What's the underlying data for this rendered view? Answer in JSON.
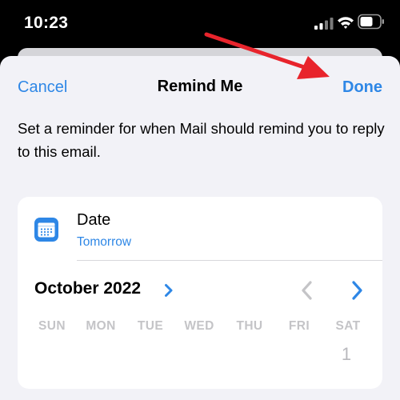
{
  "status_bar": {
    "time": "10:23",
    "icons": [
      "signal-icon",
      "wifi-icon",
      "battery-icon"
    ]
  },
  "nav": {
    "cancel_label": "Cancel",
    "title": "Remind Me",
    "done_label": "Done"
  },
  "description": "Set a reminder for when Mail should remind you to reply to this email.",
  "date_row": {
    "icon": "calendar-icon",
    "label": "Date",
    "value": "Tomorrow"
  },
  "calendar": {
    "month_year": "October 2022",
    "weekdays": [
      "SUN",
      "MON",
      "TUE",
      "WED",
      "THU",
      "FRI",
      "SAT"
    ],
    "first_day": "1"
  },
  "colors": {
    "accent": "#2e87e6",
    "sheet_background": "#f2f2f7",
    "card_background": "#ffffff",
    "annotation_arrow": "#e8242c"
  }
}
